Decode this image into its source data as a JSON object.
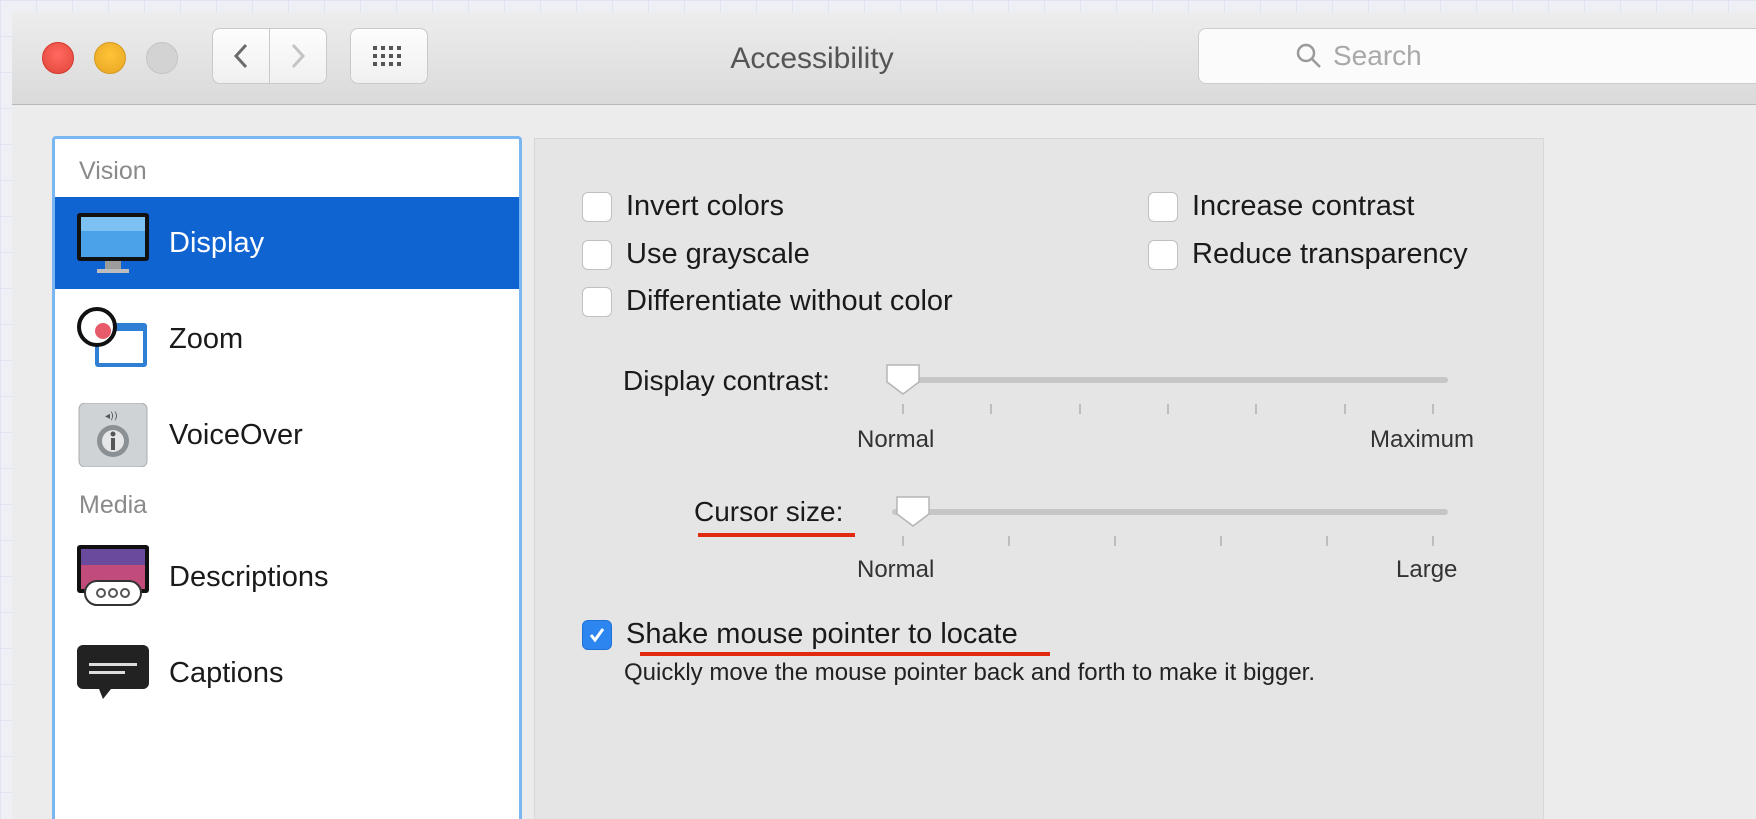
{
  "window": {
    "title": "Accessibility",
    "search_placeholder": "Search"
  },
  "sidebar": {
    "sections": [
      {
        "label": "Vision"
      },
      {
        "label": "Media"
      }
    ],
    "items": [
      {
        "label": "Display",
        "icon": "display-monitor-icon",
        "selected": true
      },
      {
        "label": "Zoom",
        "icon": "zoom-magnifier-icon"
      },
      {
        "label": "VoiceOver",
        "icon": "voiceover-icon"
      },
      {
        "label": "Descriptions",
        "icon": "descriptions-icon"
      },
      {
        "label": "Captions",
        "icon": "captions-icon"
      }
    ]
  },
  "options": {
    "invert_colors": {
      "label": "Invert colors",
      "checked": false
    },
    "use_grayscale": {
      "label": "Use grayscale",
      "checked": false
    },
    "differentiate": {
      "label": "Differentiate without color",
      "checked": false
    },
    "increase_contrast": {
      "label": "Increase contrast",
      "checked": false
    },
    "reduce_transparency": {
      "label": "Reduce transparency",
      "checked": false
    },
    "shake_pointer": {
      "label": "Shake mouse pointer to locate",
      "checked": true,
      "description": "Quickly move the mouse pointer back and forth to make it bigger."
    }
  },
  "sliders": {
    "display_contrast": {
      "label": "Display contrast:",
      "min_label": "Normal",
      "max_label": "Maximum",
      "value": 0
    },
    "cursor_size": {
      "label": "Cursor size:",
      "min_label": "Normal",
      "max_label": "Large",
      "value": 0
    }
  },
  "colors": {
    "selection": "#0f64d2",
    "annotation_underline": "#e12a0f",
    "checkbox_checked": "#2d86f0"
  }
}
